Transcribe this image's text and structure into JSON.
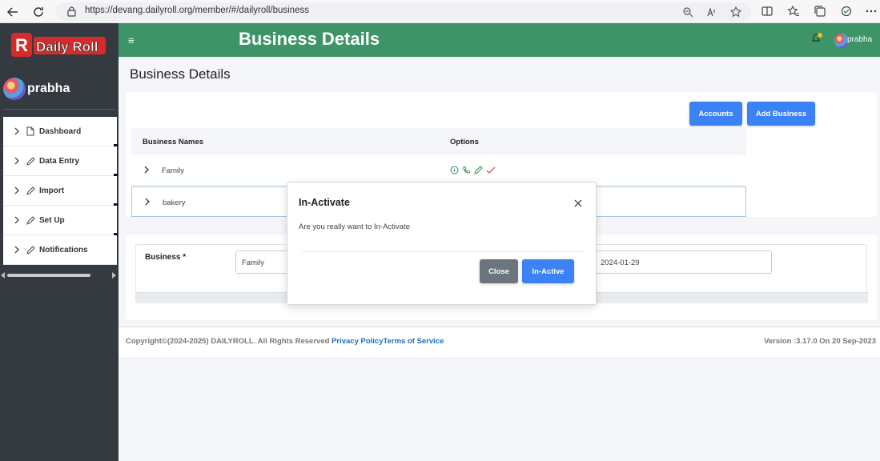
{
  "browser": {
    "url": "https://devang.dailyroll.org/member/#/dailyroll/business"
  },
  "sidebar": {
    "logo_text": "Daily Roll",
    "user_name": "prabha",
    "items": [
      {
        "label": "Dashboard",
        "icon": "file-icon"
      },
      {
        "label": "Data Entry",
        "icon": "pencil-icon"
      },
      {
        "label": "Import",
        "icon": "pencil-icon"
      },
      {
        "label": "Set Up",
        "icon": "pencil-icon"
      },
      {
        "label": "Notifications",
        "icon": "pencil-icon"
      }
    ]
  },
  "header": {
    "title": "Business Details",
    "user_name": "prabha",
    "hamburger": "≡"
  },
  "page": {
    "title": "Business Details",
    "buttons": {
      "accounts": "Accounts",
      "add_business": "Add Business"
    },
    "table": {
      "columns": [
        "Business Names",
        "Options"
      ],
      "rows": [
        {
          "name": "Family"
        },
        {
          "name": "bakery"
        }
      ]
    },
    "form": {
      "business_label": "Business *",
      "business_value": "Family",
      "date_value": "2024-01-29"
    }
  },
  "footer": {
    "copyright": "Copyright©(2024-2025) DAILYROLL. All Rights Reserved ",
    "privacy": "Privacy Policy",
    "terms": "Terms of Service",
    "version": "Version :3.17.0 On 20 Sep-2023"
  },
  "modal": {
    "title": "In-Activate",
    "body": "Are you really want to In-Activate",
    "close_label": "Close",
    "confirm_label": "In-Active"
  },
  "colors": {
    "header_green": "#3d9466",
    "sidebar_dark": "#343a40",
    "primary_blue": "#3b82f6",
    "secondary_gray": "#6c757d",
    "link_blue": "#1d6fb8"
  }
}
